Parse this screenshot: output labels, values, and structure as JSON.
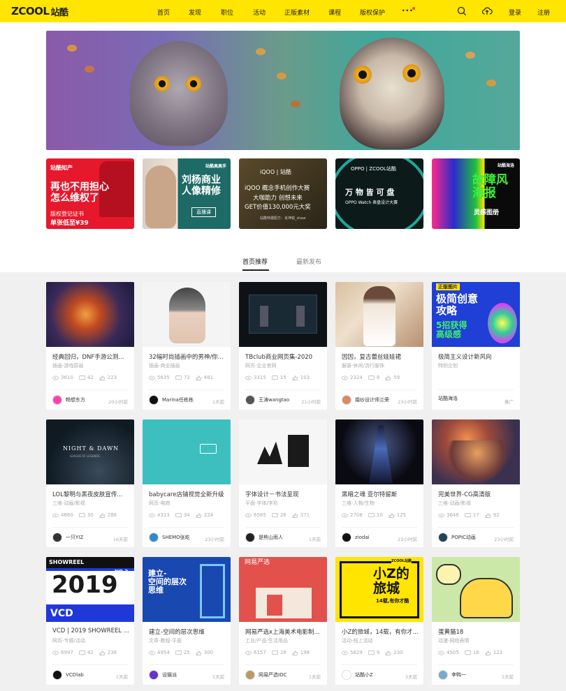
{
  "header": {
    "logo_en": "ZCOOL",
    "logo_cn": "站酷",
    "nav": [
      "首页",
      "发现",
      "职位",
      "活动",
      "正版素材",
      "课程",
      "版权保护"
    ],
    "more": "···",
    "login": "登录",
    "register": "注册",
    "icons": [
      "search-icon",
      "upload-cloud-icon"
    ]
  },
  "promos": [
    {
      "tag": "站酷知产",
      "big": "再也不用担心\n怎么维权了",
      "small1": "版权登记证书",
      "small2": "单张低至¥39"
    },
    {
      "tag": "站酷高高手",
      "big": "刘杨商业\n人像精修",
      "small1": "直播课"
    },
    {
      "tag": "iQOO | 站酷",
      "big": "iQOO 概念手机创作大赛",
      "small1": "大咖助力 创想未来",
      "small2": "GET价值130,000元大奖",
      "small3": "站酷特邀配方：肖坤锐_shaw"
    },
    {
      "tag": "OPPO | ZCOOL站酷",
      "big": "万 物 皆 可 盘",
      "small1": "OPPO Watch 表盘设计大赛"
    },
    {
      "tag": "站酷海洛",
      "big": "故障风\n海报",
      "small1": "灵感图册"
    }
  ],
  "tabs": {
    "recommend": "首页推荐",
    "latest": "最新发布"
  },
  "cards": [
    {
      "title": "经典回归，DNF手游公测...",
      "sub": "插画-游戏原画",
      "views": "3610",
      "comments": "42",
      "likes": "223",
      "author": "畅想东方",
      "time": "20小时前"
    },
    {
      "title": "32幅时尚插画中的男神/你...",
      "sub": "插画-商业插画",
      "views": "5635",
      "comments": "73",
      "likes": "481",
      "author": "Marina任栋栋",
      "time": "1天前"
    },
    {
      "title": "TBclub商业网页集-2020",
      "sub": "网页-企业官网",
      "views": "3315",
      "comments": "15",
      "likes": "103",
      "author": "王涛wangtao",
      "time": "21小时前"
    },
    {
      "title": "因因，复古蕾丝娃娃裙",
      "sub": "服装-休闲/流行服饰",
      "views": "2324",
      "comments": "8",
      "likes": "59",
      "author": "婚纱设计师兰荣",
      "time": "23小时前"
    },
    {
      "title": "极简主义设计新风向",
      "sub": "特别企划",
      "views": "",
      "comments": "",
      "likes": "",
      "author": "站酷海洛",
      "time": "推广"
    },
    {
      "title": "LOL黎明与黑夜皮肤宣传...",
      "sub": "三维-动画/影视",
      "views": "4660",
      "comments": "30",
      "likes": "286",
      "author": "一只YIZ",
      "time": "16天前"
    },
    {
      "title": "babycare店铺视觉全新升级",
      "sub": "网页-电商",
      "views": "4313",
      "comments": "34",
      "likes": "224",
      "author": "SHEMO张屹",
      "time": "23小时前"
    },
    {
      "title": "字体设计－书法呈现",
      "sub": "平面-字体/字形",
      "views": "6585",
      "comments": "26",
      "likes": "371",
      "author": "是熊山雨人",
      "time": "1天前"
    },
    {
      "title": "黑暗之魂 亚尔特留斯",
      "sub": "三维-人物/生物",
      "views": "2708",
      "comments": "10",
      "likes": "125",
      "author": "ziodai",
      "time": "22小时前"
    },
    {
      "title": "完美世界-CG高清版",
      "sub": "三维-动画/影视",
      "views": "3646",
      "comments": "17",
      "likes": "92",
      "author": "POPIC动画",
      "time": "23小时前"
    },
    {
      "title": "VCD | 2019 SHOWREEL ...",
      "sub": "网页-专题/活动",
      "views": "6997",
      "comments": "42",
      "likes": "238",
      "author": "VCDlab",
      "time": "1天前"
    },
    {
      "title": "建立-空间的层次思维",
      "sub": "文章-教程-平面",
      "views": "4954",
      "comments": "25",
      "likes": "300",
      "author": "设猫派",
      "time": "1天前"
    },
    {
      "title": "网易严选x上海美术电影制...",
      "sub": "工业/产品-生活用品",
      "views": "6157",
      "comments": "28",
      "likes": "198",
      "author": "网易严选IDC",
      "time": "1天前"
    },
    {
      "title": "小Z的旅城，14载，有你才...",
      "sub": "活动-线上活动",
      "views": "5829",
      "comments": "9",
      "likes": "230",
      "author": "站酷小Z",
      "time": "3天前"
    },
    {
      "title": "蛋黄猫18",
      "sub": "动漫-网络表情",
      "views": "4505",
      "comments": "16",
      "likes": "123",
      "author": "李鸭一",
      "time": "1天前"
    }
  ],
  "thumb_text": {
    "c4_tag": "正版图片",
    "c4_big": "极简创意\n攻略",
    "c4_s": "5招获得\n高级感",
    "c5_big": "NIGHT & DAWN",
    "c5_s": "LEAGUE OF LEGENDS",
    "c10_big": "2019",
    "c10_top": "SHOWREEL",
    "c10_no": "NO.2",
    "c10_vcd": "VCD",
    "c11_big": "建立-\n空间的层次\n思维",
    "c12_brand": "网易严选",
    "c13_top": "ZCOOL站酷",
    "c13_big": "小Z的\n旅城",
    "c13_s": "14载,有你才酷"
  }
}
